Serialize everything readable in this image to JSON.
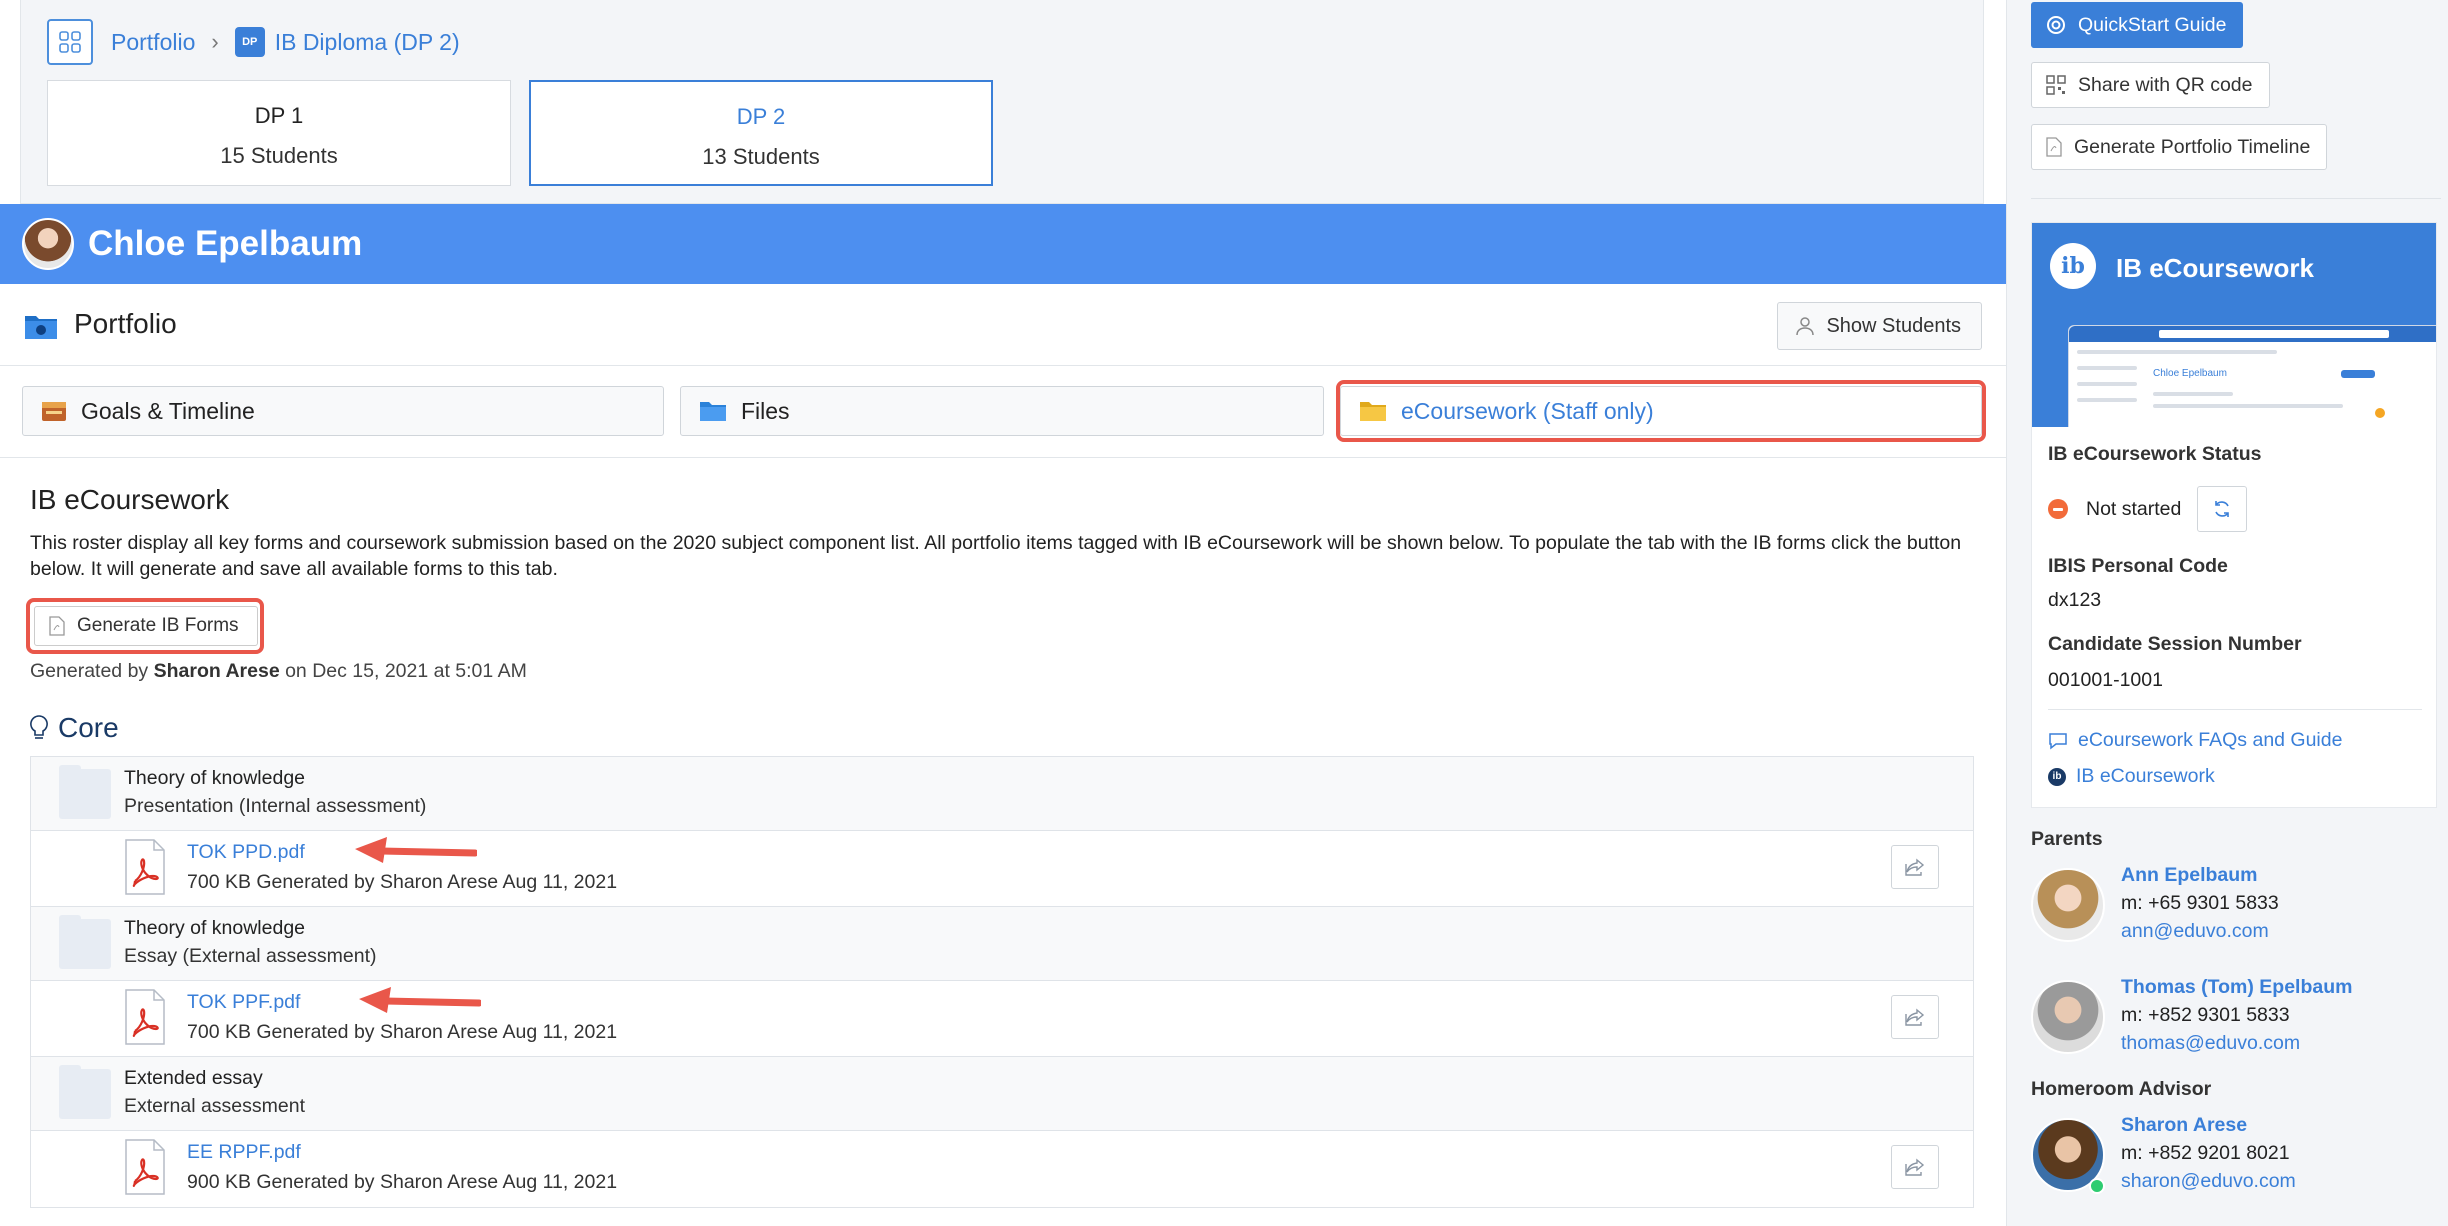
{
  "breadcrumb": {
    "portfolio": "Portfolio",
    "separator": "›",
    "badge": "DP",
    "program": "IB Diploma (DP 2)"
  },
  "classes": [
    {
      "title": "DP 1",
      "count": "15 Students"
    },
    {
      "title": "DP 2",
      "count": "13 Students"
    }
  ],
  "student": {
    "name": "Chloe Epelbaum"
  },
  "portfolio": {
    "title": "Portfolio",
    "show_students": "Show Students"
  },
  "tabs": [
    {
      "label": "Goals & Timeline"
    },
    {
      "label": "Files"
    },
    {
      "label": "eCoursework (Staff only)"
    }
  ],
  "ecoursework": {
    "heading": "IB eCoursework",
    "description": "This roster display all key forms and coursework submission based on the 2020 subject component list. All portfolio items tagged with IB eCoursework will be shown below. To populate the tab with the IB forms click the button below. It will generate and save all available forms to this tab.",
    "generate_button": "Generate IB Forms",
    "generated_prefix": "Generated by ",
    "generated_by": "Sharon Arese",
    "generated_suffix": " on Dec 15, 2021 at 5:01 AM"
  },
  "core": {
    "heading": "Core",
    "items": [
      {
        "title": "Theory of knowledge",
        "subtitle": "Presentation (Internal assessment)",
        "file": {
          "name": "TOK PPD.pdf",
          "meta": "700 KB Generated by Sharon Arese Aug 11, 2021"
        }
      },
      {
        "title": "Theory of knowledge",
        "subtitle": "Essay (External assessment)",
        "file": {
          "name": "TOK PPF.pdf",
          "meta": "700 KB Generated by Sharon Arese Aug 11, 2021"
        }
      },
      {
        "title": "Extended essay",
        "subtitle": "External assessment",
        "file": {
          "name": "EE RPPF.pdf",
          "meta": "900 KB Generated by Sharon Arese Aug 11, 2021"
        }
      }
    ]
  },
  "sidebar": {
    "quickstart": "QuickStart Guide",
    "qr": "Share with QR code",
    "timeline": "Generate Portfolio Timeline",
    "panel": {
      "logo": "ib",
      "title": "IB eCoursework",
      "mini_name": "Chloe Epelbaum",
      "status_label": "IB eCoursework Status",
      "status_value": "Not started",
      "ibis_label": "IBIS Personal Code",
      "ibis_value": "dx123",
      "session_label": "Candidate Session Number",
      "session_value": "001001-1001",
      "link_faq": "eCoursework FAQs and Guide",
      "link_ib": "IB eCoursework"
    },
    "parents_title": "Parents",
    "parents": [
      {
        "name": "Ann Epelbaum",
        "phone": "m: +65 9301 5833",
        "email": "ann@eduvo.com"
      },
      {
        "name": "Thomas (Tom) Epelbaum",
        "phone": "m: +852 9301 5833",
        "email": "thomas@eduvo.com"
      }
    ],
    "advisor_title": "Homeroom Advisor",
    "advisor": {
      "name": "Sharon Arese",
      "phone": "m: +852 9201 8021",
      "email": "sharon@eduvo.com"
    }
  },
  "colors": {
    "accent": "#3a7fd8",
    "student_bar": "#4d8ff0",
    "highlight": "#e9574a",
    "status_not_started": "#f26b3a"
  }
}
